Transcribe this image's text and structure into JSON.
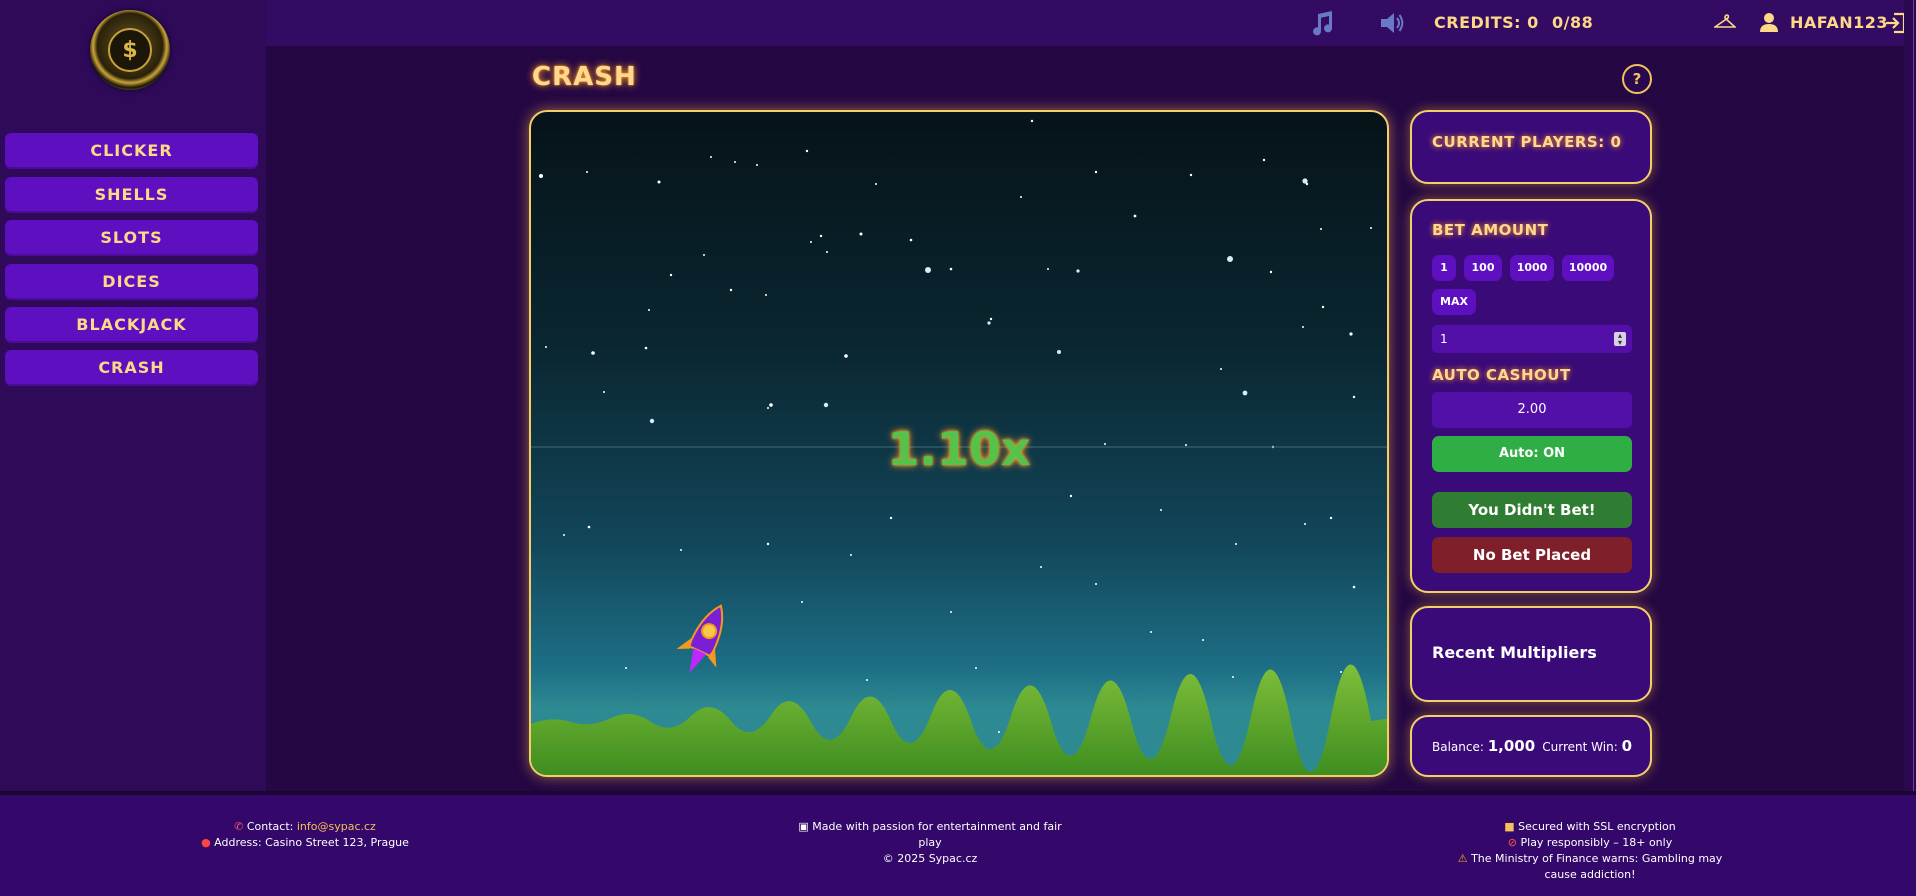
{
  "sidebar": {
    "logo_text": "$",
    "items": [
      {
        "label": "CLICKER"
      },
      {
        "label": "SHELLS"
      },
      {
        "label": "SLOTS"
      },
      {
        "label": "DICES"
      },
      {
        "label": "BLACKJACK"
      },
      {
        "label": "CRASH"
      }
    ]
  },
  "topbar": {
    "credits": "CREDITS: 0",
    "progress": "0/88",
    "username": "HAFAN123",
    "icons": [
      "music-note-icon",
      "speaker-icon",
      "hanger-icon",
      "user-icon",
      "logout-icon"
    ]
  },
  "page": {
    "title": "CRASH",
    "help": "?"
  },
  "game": {
    "multiplier": "1.10x"
  },
  "panels": {
    "players": {
      "title": "CURRENT PLAYERS: 0"
    },
    "bet": {
      "title": "BET AMOUNT",
      "chips": [
        "1",
        "100",
        "1000",
        "10000",
        "MAX"
      ],
      "amount_value": "1",
      "auto_cashout_title": "AUTO CASHOUT",
      "auto_cashout_value": "2.00",
      "auto_btn": "Auto: ON",
      "status_btn": "You Didn't Bet!",
      "no_bet_btn": "No Bet Placed"
    },
    "recent": {
      "title": "Recent Multipliers"
    },
    "balance": {
      "balance_label": "Balance:",
      "balance_value": "1,000",
      "win_label": "Current Win:",
      "win_value": "0"
    }
  },
  "footer": {
    "contact_label": "Contact:",
    "contact_email": "info@sypac.cz",
    "address": "Address: Casino Street 123, Prague",
    "made_line1": "Made with passion for entertainment and fair",
    "made_line2": "play",
    "copyright": "© 2025 Sypac.cz",
    "ssl": "Secured with SSL encryption",
    "responsible": "Play responsibly – 18+ only",
    "warning_line1": "The Ministry of Finance warns: Gambling may",
    "warning_line2": "cause addiction!"
  },
  "colors": {
    "accent_gold": "#ffd890",
    "nav_purple": "#5e0fc0",
    "auto_green": "#2fae46",
    "status_green": "#2e7d32",
    "no_bet_red": "#7e1f2a"
  }
}
